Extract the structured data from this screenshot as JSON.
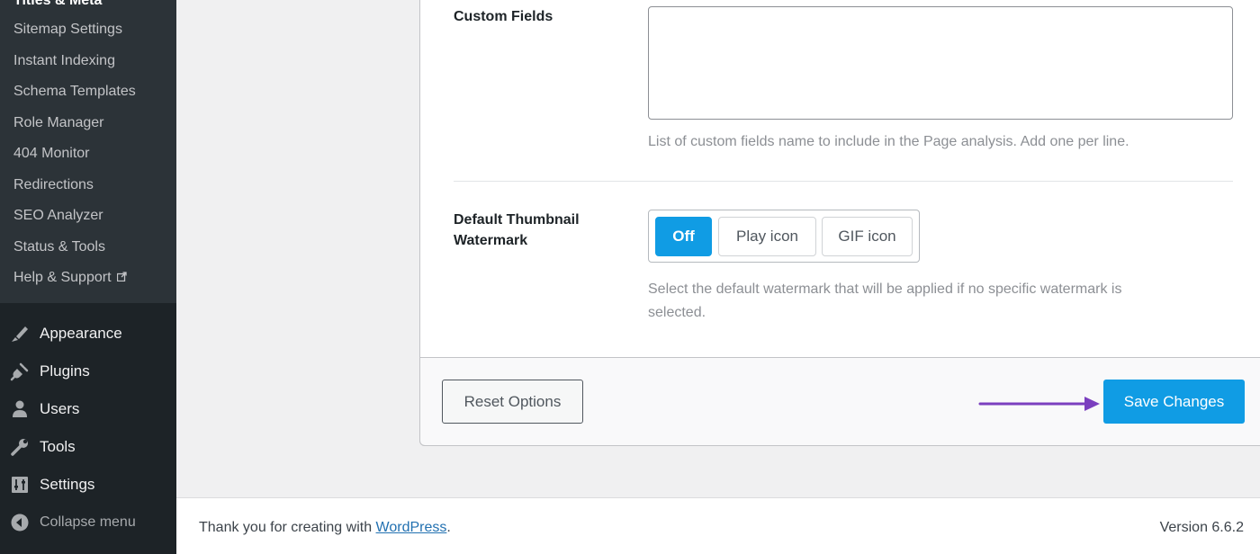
{
  "sidebar": {
    "submenu": [
      {
        "label": "Titles & Meta",
        "cut": true
      },
      {
        "label": "Sitemap Settings"
      },
      {
        "label": "Instant Indexing"
      },
      {
        "label": "Schema Templates"
      },
      {
        "label": "Role Manager"
      },
      {
        "label": "404 Monitor"
      },
      {
        "label": "Redirections"
      },
      {
        "label": "SEO Analyzer"
      },
      {
        "label": "Status & Tools"
      },
      {
        "label": "Help & Support",
        "external": true
      }
    ],
    "menu": [
      {
        "label": "Appearance",
        "icon": "brush-icon"
      },
      {
        "label": "Plugins",
        "icon": "plug-icon"
      },
      {
        "label": "Users",
        "icon": "user-icon"
      },
      {
        "label": "Tools",
        "icon": "wrench-icon"
      },
      {
        "label": "Settings",
        "icon": "sliders-icon"
      },
      {
        "label": "Collapse menu",
        "icon": "collapse-icon"
      }
    ]
  },
  "custom_fields": {
    "label": "Custom Fields",
    "value": "",
    "description": "List of custom fields name to include in the Page analysis. Add one per line."
  },
  "watermark": {
    "label_line1": "Default Thumbnail",
    "label_line2": "Watermark",
    "options": [
      "Off",
      "Play icon",
      "GIF icon"
    ],
    "selected": "Off",
    "description_line1": "Select the default watermark that will be applied if no specific watermark is",
    "description_line2": "selected."
  },
  "actions": {
    "reset_label": "Reset Options",
    "save_label": "Save Changes"
  },
  "footer": {
    "thanks_prefix": "Thank you for creating with ",
    "thanks_link": "WordPress",
    "thanks_suffix": ".",
    "version": "Version 6.6.2"
  },
  "colors": {
    "accent": "#109ce4",
    "sidebar_bg": "#1d2327",
    "submenu_bg": "#2c3338",
    "arrow": "#7b3fbf"
  }
}
